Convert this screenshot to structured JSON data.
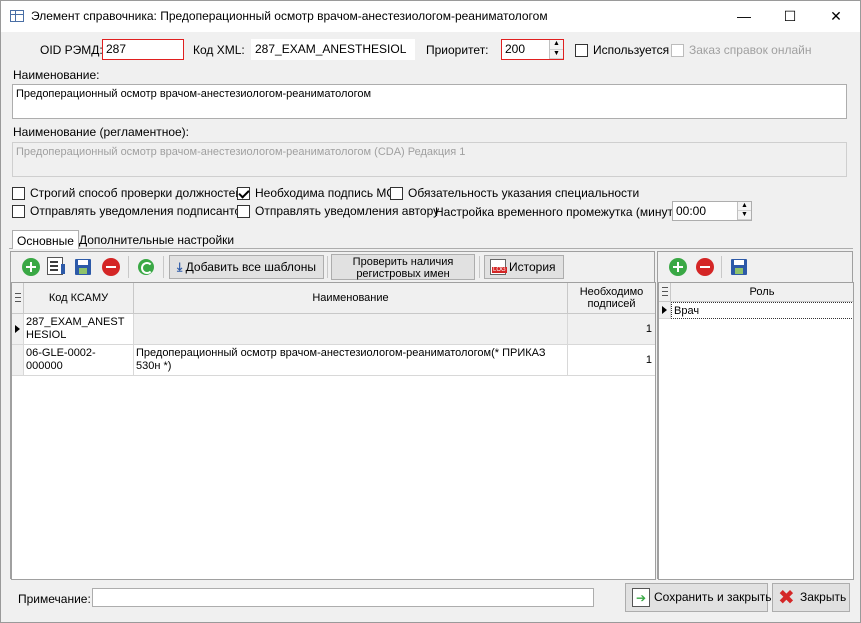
{
  "window": {
    "title": "Элемент справочника: Предоперационный осмотр врачом-анестезиологом-реаниматологом",
    "minimize": "—",
    "maximize": "☐",
    "close": "✕"
  },
  "form": {
    "oid_label": "OID РЭМД:",
    "oid_value": "287",
    "xml_label": "Код XML:",
    "xml_value": "287_EXAM_ANESTHESIOL",
    "priority_label": "Приоритет:",
    "priority_value": "200",
    "used_label": "Используется",
    "used_checked": false,
    "online_label": "Заказ справок онлайн",
    "online_checked": false,
    "name_label": "Наименование:",
    "name_value": "Предоперационный осмотр врачом-анестезиологом-реаниматологом",
    "reg_name_label": "Наименование (регламентное):",
    "reg_name_value": "Предоперационный осмотр врачом-анестезиологом-реаниматологом (CDA) Редакция 1",
    "strict_label": "Строгий способ проверки должностей",
    "strict_checked": false,
    "mo_sign_label": "Необходима подпись МО",
    "mo_sign_checked": true,
    "spec_label": "Обязательность указания специальности",
    "spec_checked": false,
    "notify_signers_label": "Отправлять уведомления подписантов",
    "notify_signers_checked": false,
    "notify_author_label": "Отправлять уведомления автору",
    "notify_author_checked": false,
    "interval_label": "Настройка временного промежутка (минуты):",
    "interval_value": "00:00"
  },
  "tabs": [
    {
      "label": "Основные",
      "active": true
    },
    {
      "label": "Дополнительные настройки",
      "active": false
    }
  ],
  "toolbar": {
    "add_all_label": "Добавить все шаблоны",
    "check_reg_label_line1": "Проверить наличия",
    "check_reg_label_line2": "регистровых имен",
    "history_label": "История",
    "log_badge": "LOG"
  },
  "main_grid": {
    "headers": {
      "code": "Код КСАМУ",
      "name": "Наименование",
      "signs_line1": "Необходимо",
      "signs_line2": "подписей"
    },
    "rows": [
      {
        "code": "287_EXAM_ANESTHESIOL",
        "name": "",
        "signs": "1",
        "current": true
      },
      {
        "code": "06-GLE-0002-000000",
        "name": "Предоперационный осмотр врачом-анестезиологом-реаниматологом(* ПРИКАЗ 530н *)",
        "signs": "1",
        "current": false
      }
    ]
  },
  "role_grid": {
    "header": "Роль",
    "rows": [
      {
        "role": "Врач",
        "current": true
      }
    ]
  },
  "footer": {
    "note_label": "Примечание:",
    "note_value": "",
    "save_close_label": "Сохранить и закрыть",
    "close_label": "Закрыть"
  },
  "colors": {
    "required_border": "#e02020",
    "add_icon": "#3aa845",
    "remove_icon": "#d42626",
    "save_icon": "#2d5aa8"
  }
}
